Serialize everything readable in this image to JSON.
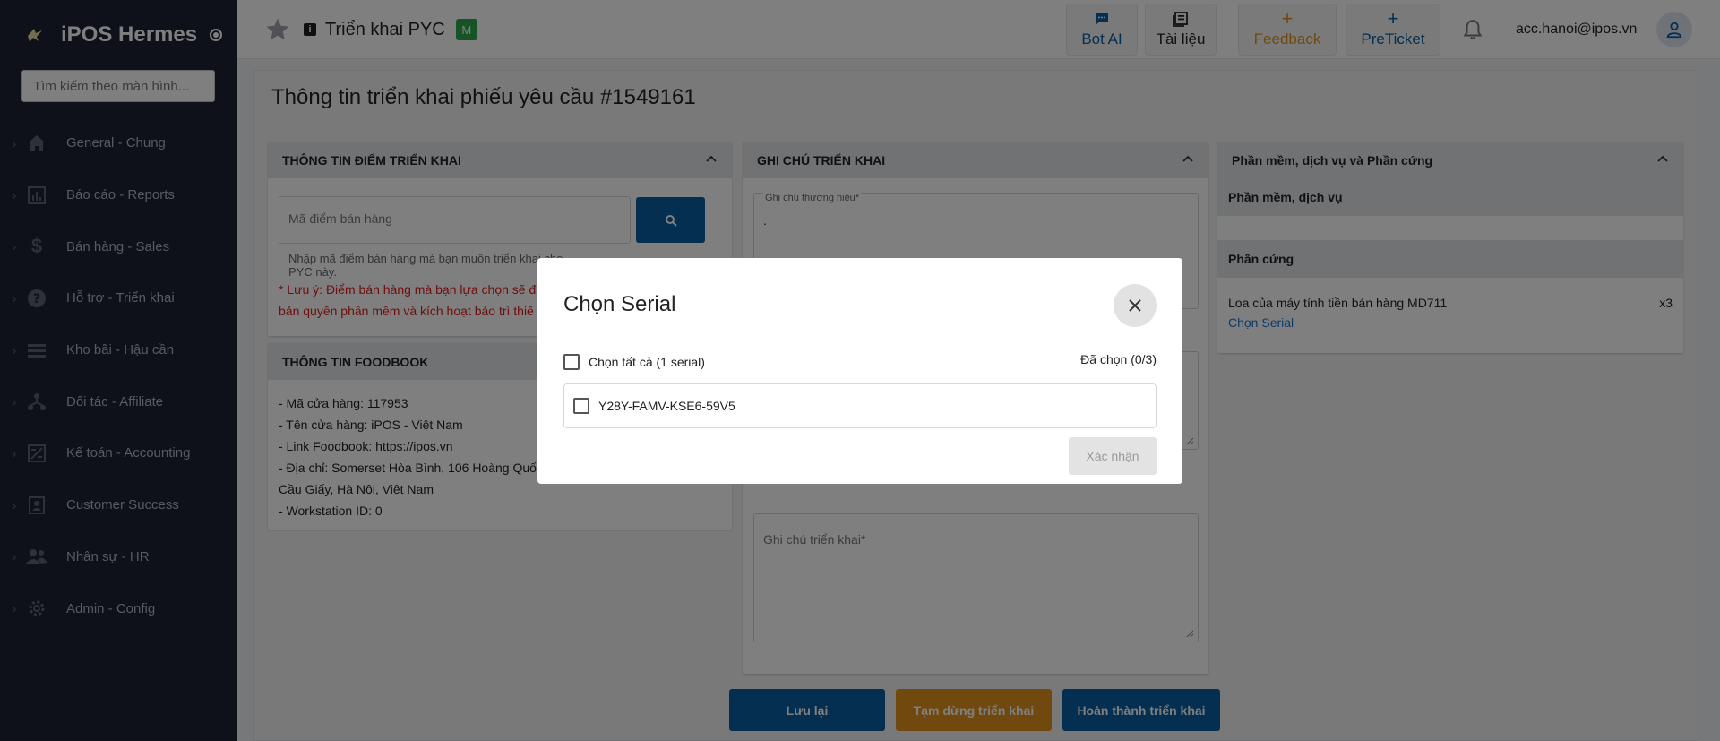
{
  "app": {
    "name": "iPOS Hermes"
  },
  "sidebar": {
    "search_placeholder": "Tìm kiếm theo màn hình...",
    "items": [
      {
        "label": "General - Chung",
        "icon": "home-icon"
      },
      {
        "label": "Báo cáo - Reports",
        "icon": "chart-icon"
      },
      {
        "label": "Bán hàng - Sales",
        "icon": "dollar-icon"
      },
      {
        "label": "Hỗ trợ - Triển khai",
        "icon": "help-icon"
      },
      {
        "label": "Kho bãi - Hậu cần",
        "icon": "list-icon"
      },
      {
        "label": "Đối tác - Affiliate",
        "icon": "network-icon"
      },
      {
        "label": "Kế toán - Accounting",
        "icon": "accounting-icon"
      },
      {
        "label": "Customer Success",
        "icon": "contact-icon"
      },
      {
        "label": "Nhân sự - HR",
        "icon": "people-icon"
      },
      {
        "label": "Admin - Config",
        "icon": "gear-icon"
      }
    ]
  },
  "topbar": {
    "page": "Triển khai PYC",
    "badge": "M",
    "buttons": {
      "bot": "Bot AI",
      "docs": "Tài liệu",
      "feedback": "Feedback",
      "preticket": "PreTicket"
    },
    "user_email": "acc.hanoi@ipos.vn"
  },
  "main": {
    "title": "Thông tin triển khai phiếu yêu cầu #1549161",
    "deploy_point": {
      "header": "THÔNG TIN ĐIỂM TRIỂN KHAI",
      "input_placeholder": "Mã điểm bán hàng",
      "helper_line1": "Nhập mã điểm bán hàng mà bạn muốn triển khai cho",
      "helper_line2": "PYC này.",
      "warn_line1": "* Lưu ý: Điểm bán hàng mà bạn lựa chọn sẽ đ",
      "warn_line2": "bản quyền phần mềm và kích hoạt bảo trì thiế"
    },
    "foodbook": {
      "header": "THÔNG TIN FOODBOOK",
      "lines": [
        "- Mã cửa hàng: 117953",
        "- Tên cửa hàng: iPOS - Việt Nam",
        "- Link Foodbook: https://ipos.vn",
        "- Địa chỉ: Somerset Hòa Bình, 106 Hoàng Quố",
        "Cầu Giấy, Hà Nội, Việt Nam",
        "- Workstation ID: 0"
      ]
    },
    "notes": {
      "header": "GHI CHÚ TRIỂN KHAI",
      "brand_label": "Ghi chú thương hiệu*",
      "brand_value": ".",
      "deploy_placeholder": "Ghi chú triển khai*"
    },
    "software": {
      "header": "Phần mềm, dịch vụ và Phần cứng",
      "software_sub": "Phần mềm, dịch vụ",
      "hardware_sub": "Phần cứng",
      "hw_item": "Loa của máy tính tiền bán hàng MD711",
      "hw_qty": "x3",
      "choose_serial_link": "Chọn Serial"
    },
    "actions": {
      "save": "Lưu lại",
      "pause": "Tạm dừng triển khai",
      "complete": "Hoàn thành triển khai"
    }
  },
  "modal": {
    "title": "Chọn Serial",
    "select_all": "Chọn tất cả (1 serial)",
    "chosen": "Đã chọn (0/3)",
    "serials": [
      "Y28Y-FAMV-KSE6-59V5"
    ],
    "confirm": "Xác nhận"
  },
  "colors": {
    "sidebar_bg": "#1c2333",
    "primary_blue": "#0a5fa0",
    "orange": "#e3921e",
    "warn_red": "#e01b1b",
    "badge_green": "#2aa84a"
  }
}
